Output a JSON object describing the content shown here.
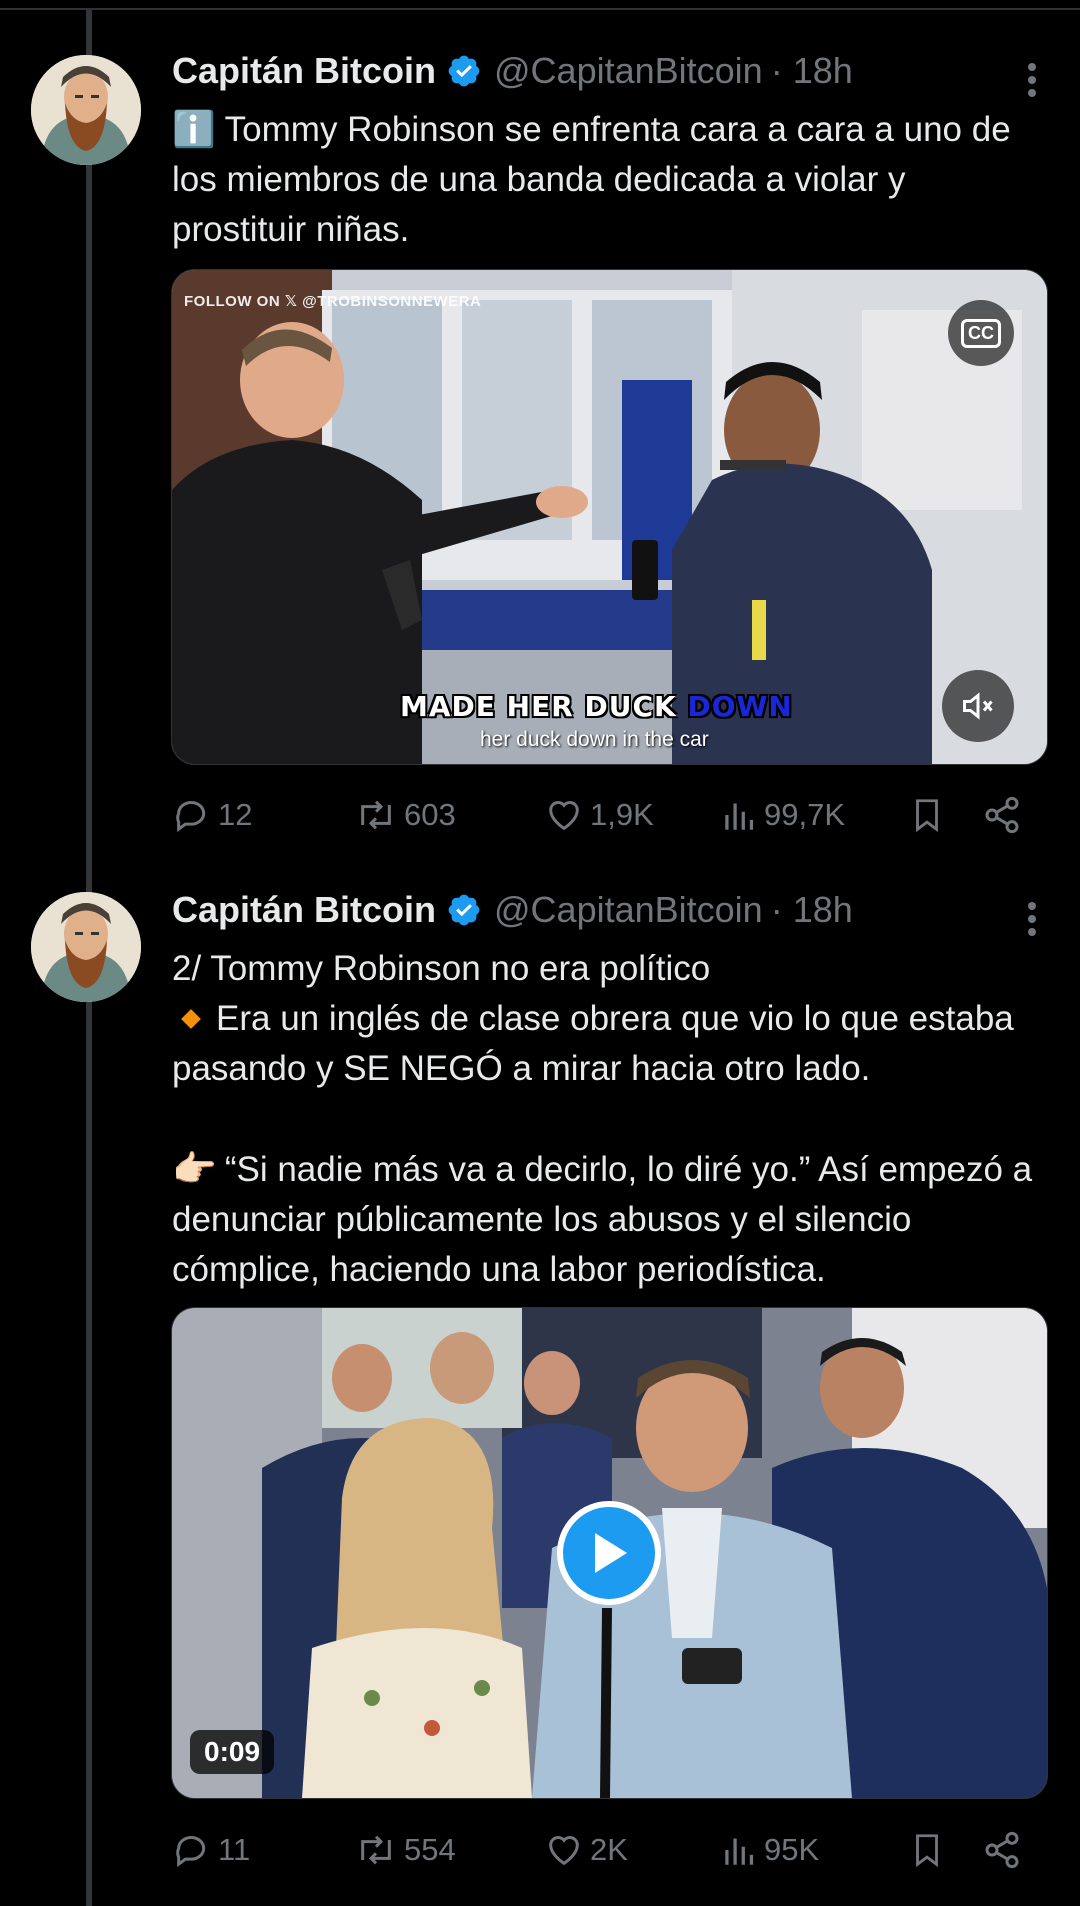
{
  "tweets": [
    {
      "author_name": "Capitán Bitcoin",
      "handle": "@CapitanBitcoin",
      "time": "· 18h",
      "lines": [
        {
          "emoji": "info",
          "text": "ℹ️ Tommy Robinson se enfrenta cara a cara a uno de los miembros de una banda dedicada a violar y prostituir niñas."
        }
      ],
      "media": {
        "kind": "video-autoplay",
        "watermark": "FOLLOW ON 𝕏 @TROBINSONNEWERA",
        "caption_big_white": "MADE HER DUCK ",
        "caption_big_highlight": "DOWN",
        "caption_small": "her duck down in the car",
        "cc_label": "CC"
      },
      "stats": {
        "replies": "12",
        "reposts": "603",
        "likes": "1,9K",
        "views": "99,7K"
      }
    },
    {
      "author_name": "Capitán Bitcoin",
      "handle": "@CapitanBitcoin",
      "time": "· 18h",
      "line1": "2/ Tommy Robinson no era político",
      "line2": "Era un inglés de clase obrera que vio lo que estaba pasando y SE NEGÓ a mirar hacia otro lado.",
      "line3": "“Si nadie más va a decirlo, lo diré yo.” Así empezó a denunciar públicamente los abusos y el silencio cómplice, haciendo una labor periodística.",
      "media": {
        "kind": "video",
        "duration": "0:09"
      },
      "stats": {
        "replies": "11",
        "reposts": "554",
        "likes": "2K",
        "views": "95K"
      }
    }
  ],
  "colors": {
    "background": "#000000",
    "text": "#e7e9ea",
    "muted": "#71767b",
    "accent": "#1d9bf0",
    "thread_line": "#333639"
  },
  "icons": [
    "verified-badge-icon",
    "more-options-icon",
    "reply-icon",
    "repost-icon",
    "like-icon",
    "views-icon",
    "bookmark-icon",
    "share-icon",
    "cc-icon",
    "mute-icon",
    "play-icon"
  ]
}
